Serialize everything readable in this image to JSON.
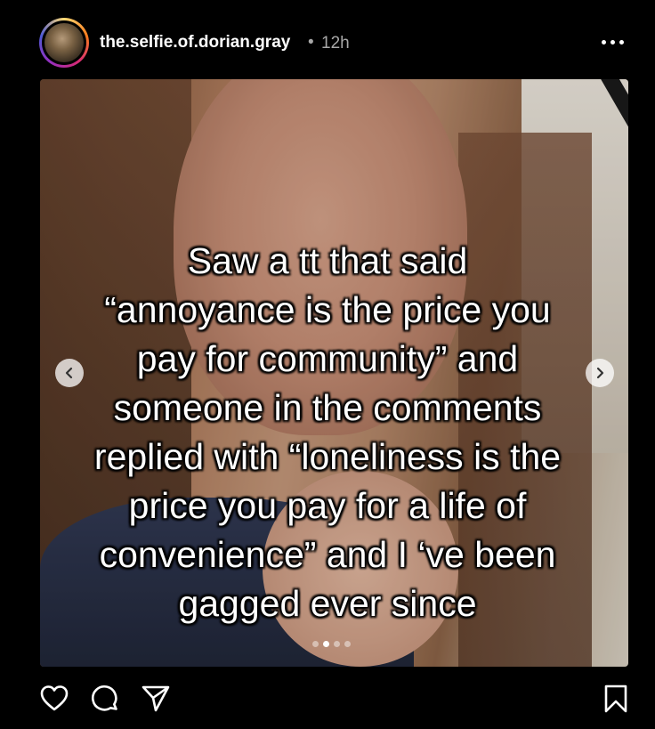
{
  "post": {
    "username": "the.selfie.of.dorian.gray",
    "separator": "•",
    "time": "12h"
  },
  "caption_lines": [
    "Saw a tt that said",
    "“annoyance is the price you",
    "pay for community” and",
    "someone in the comments",
    "replied with “loneliness is the",
    "price you pay for a life of",
    "convenience” and I ‘ve been",
    "gagged ever since"
  ],
  "carousel": {
    "total_slides": 4,
    "active_index": 1
  },
  "icons": {
    "more": "more-horizontal-icon",
    "prev": "chevron-left-icon",
    "next": "chevron-right-icon",
    "like": "heart-icon",
    "comment": "comment-icon",
    "share": "send-icon",
    "save": "bookmark-icon"
  }
}
